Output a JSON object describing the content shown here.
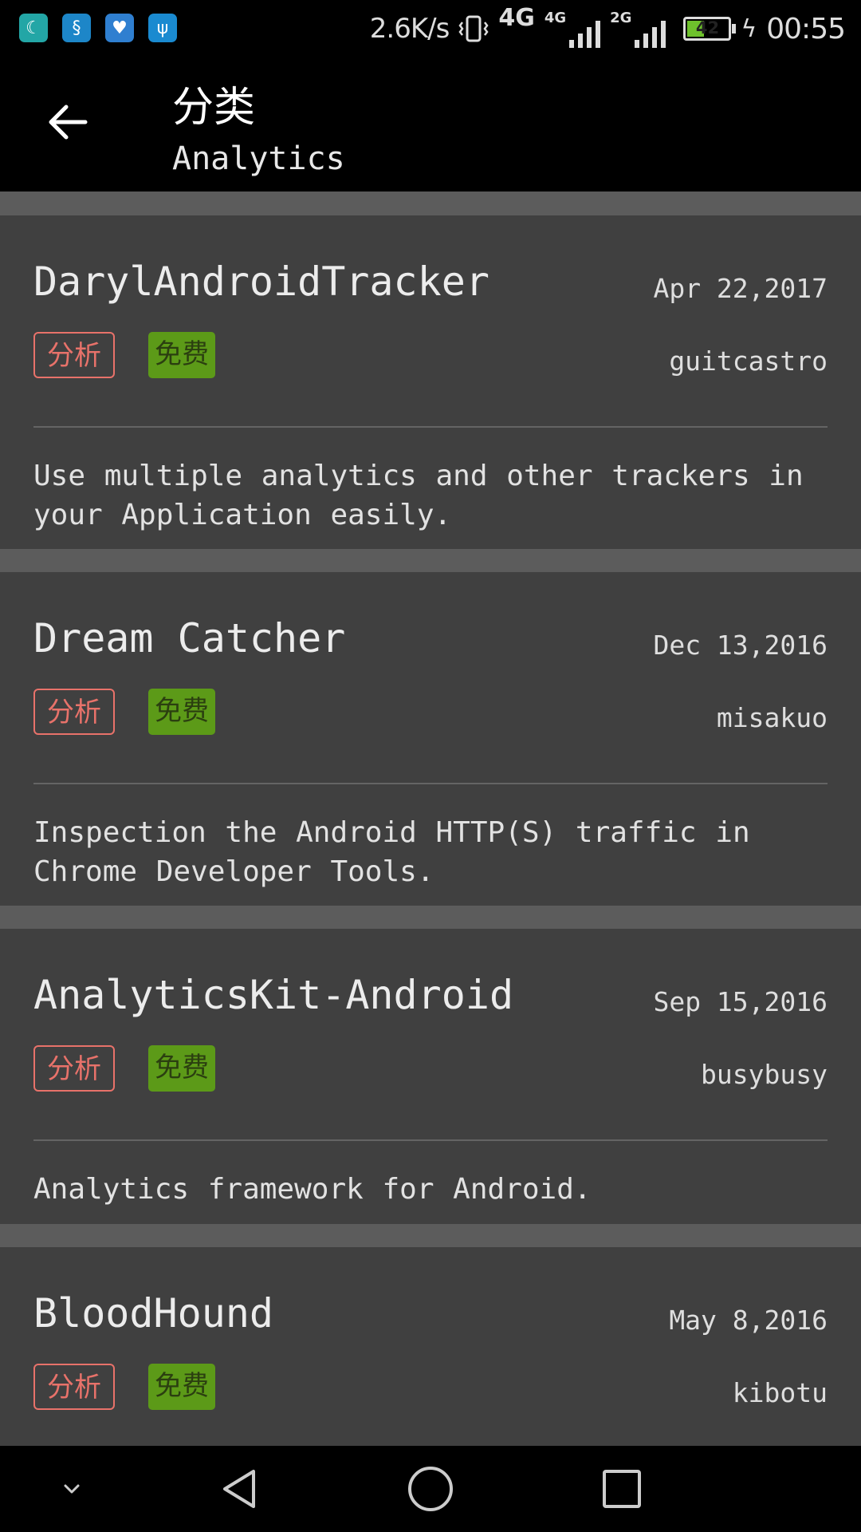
{
  "status_bar": {
    "net_speed": "2.6K/s",
    "network_1": "4G",
    "network_2": "4G",
    "network_3": "2G",
    "battery_level": "42",
    "battery_percent": 42,
    "time": "00:55",
    "icons": [
      "moon-icon",
      "swirl-icon",
      "heart-monitor-icon",
      "usb-icon"
    ]
  },
  "toolbar": {
    "title": "分类",
    "subtitle": "Analytics"
  },
  "items": [
    {
      "title": "DarylAndroidTracker",
      "date": "Apr 22,2017",
      "category_tag": "分析",
      "price_tag": "免费",
      "author": "guitcastro",
      "description": "Use multiple analytics and other trackers in your Application easily."
    },
    {
      "title": "Dream Catcher",
      "date": "Dec 13,2016",
      "category_tag": "分析",
      "price_tag": "免费",
      "author": "misakuo",
      "description": "Inspection the Android HTTP(S) traffic in Chrome Developer Tools."
    },
    {
      "title": "AnalyticsKit-Android",
      "date": "Sep 15,2016",
      "category_tag": "分析",
      "price_tag": "免费",
      "author": "busybusy",
      "description": "Analytics framework for Android."
    },
    {
      "title": "BloodHound",
      "date": "May 8,2016",
      "category_tag": "分析",
      "price_tag": "免费",
      "author": "kibotu",
      "description": ""
    }
  ],
  "colors": {
    "card_background": "#404040",
    "list_background": "#5c5c5c",
    "category_tag": "#e8726a",
    "price_tag": "#5c9a18"
  }
}
